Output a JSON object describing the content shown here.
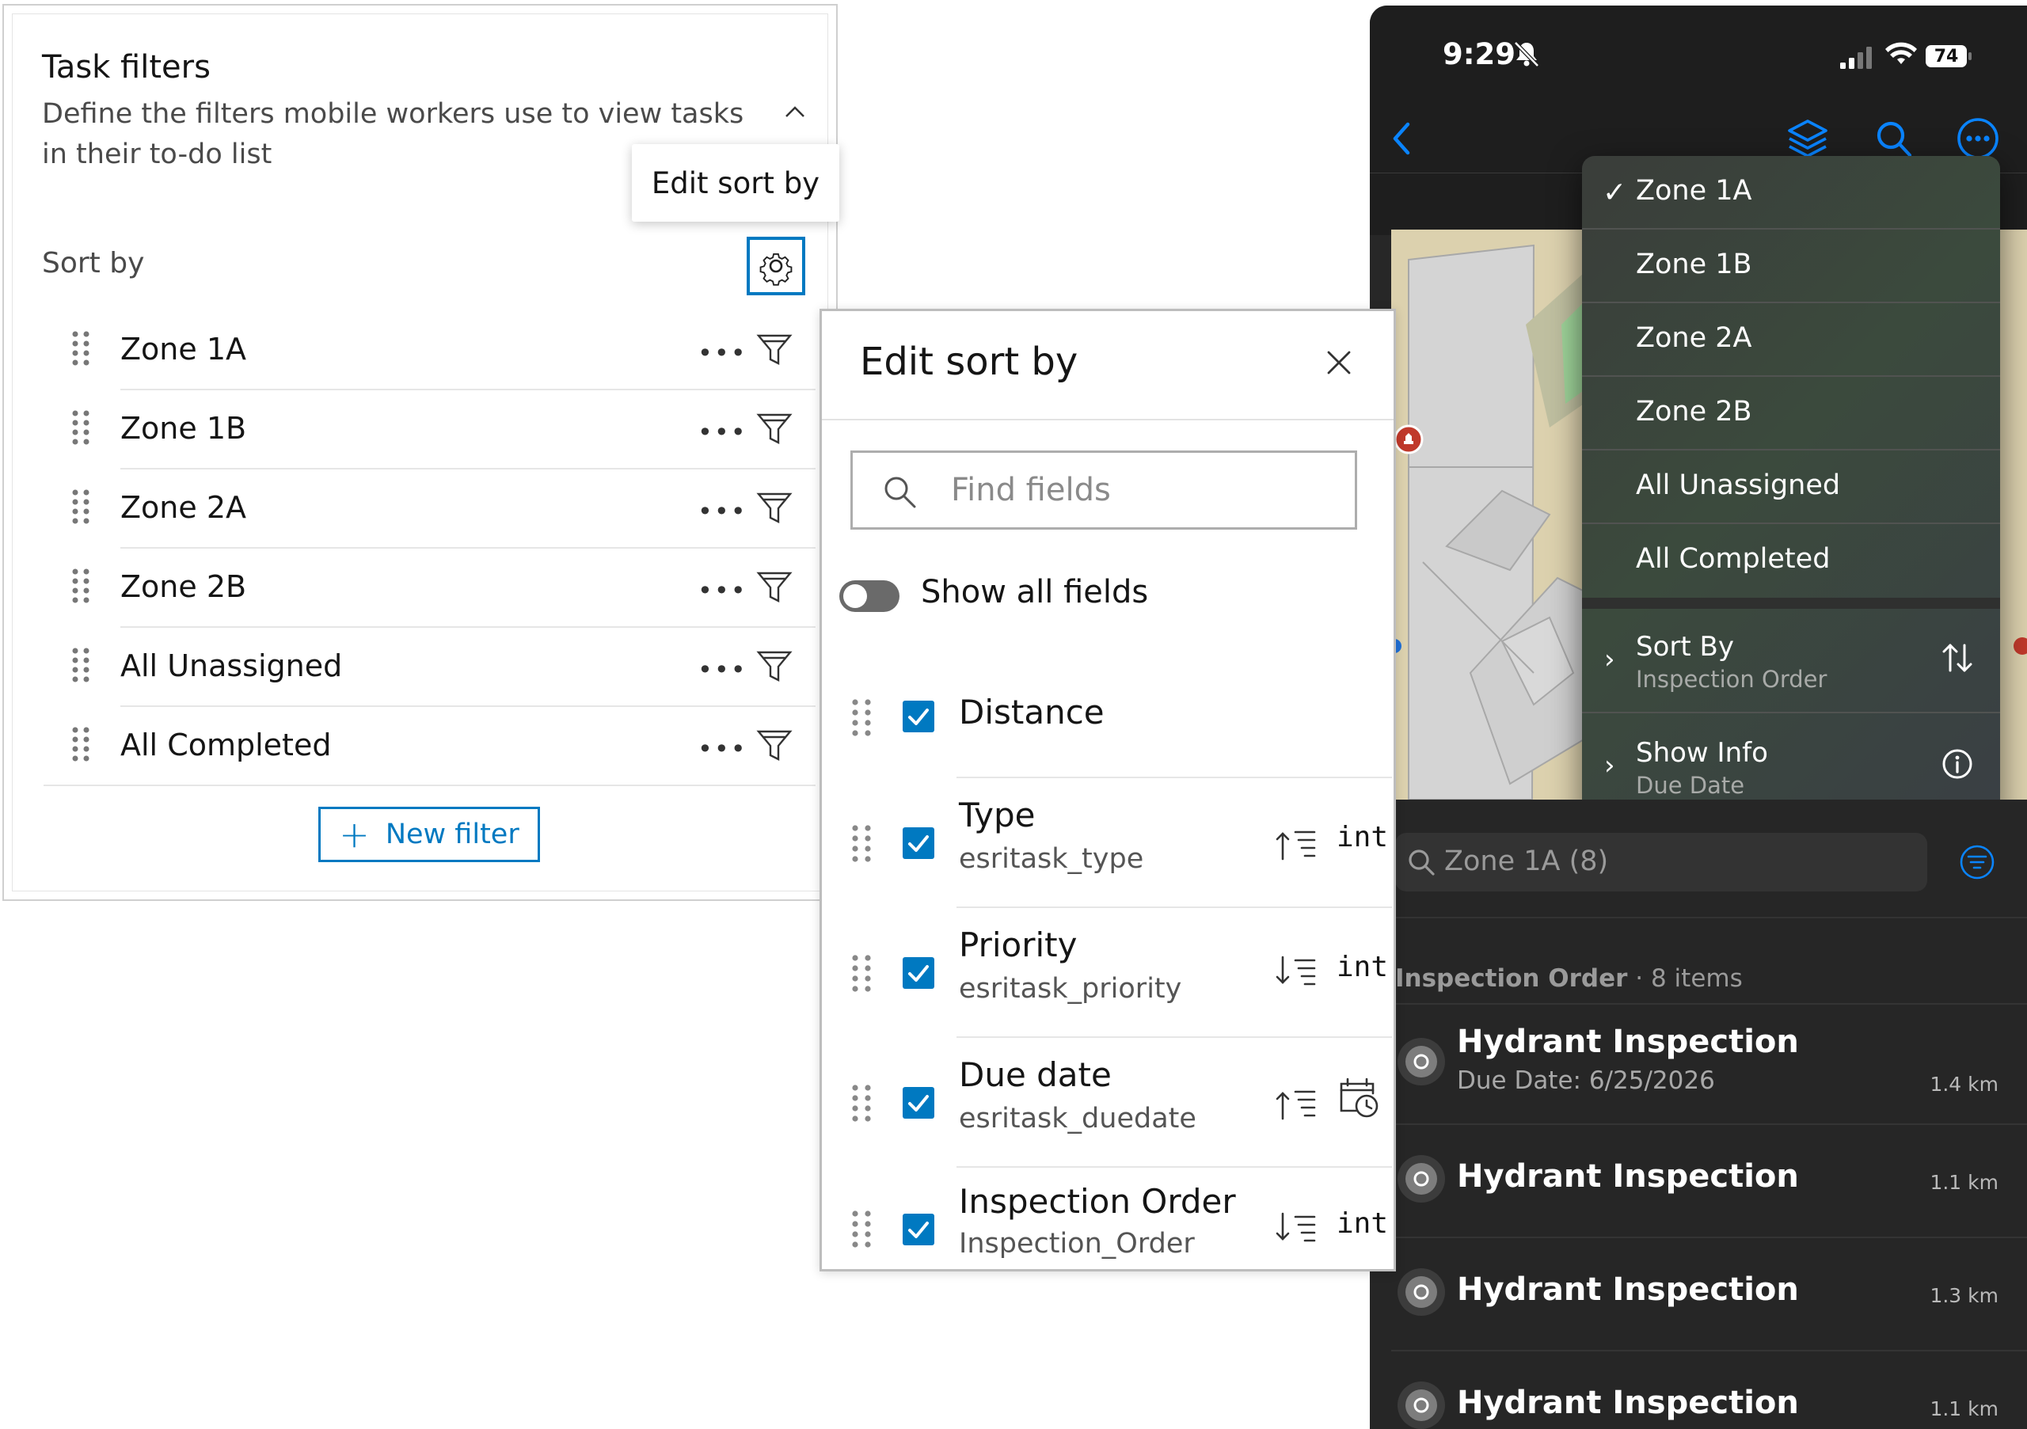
{
  "task_filters": {
    "title": "Task filters",
    "description": "Define the filters mobile workers use to view tasks in their to-do list",
    "tooltip": "Edit sort by",
    "sort_by_label": "Sort by",
    "filters": [
      {
        "label": "Zone 1A"
      },
      {
        "label": "Zone 1B"
      },
      {
        "label": "Zone 2A"
      },
      {
        "label": "Zone 2B"
      },
      {
        "label": "All Unassigned"
      },
      {
        "label": "All Completed"
      }
    ],
    "more_glyph": "•••",
    "new_filter_label": "New filter"
  },
  "edit_sort": {
    "title": "Edit sort by",
    "search_placeholder": "Find fields",
    "show_all_label": "Show all fields",
    "show_all_on": false,
    "fields": [
      {
        "name": "Distance",
        "field": "",
        "checked": true,
        "sort": "",
        "type": ""
      },
      {
        "name": "Type",
        "field": "esritask_type",
        "checked": true,
        "sort": "ascending",
        "type": "int"
      },
      {
        "name": "Priority",
        "field": "esritask_priority",
        "checked": true,
        "sort": "descending",
        "type": "int"
      },
      {
        "name": "Due date",
        "field": "esritask_duedate",
        "checked": true,
        "sort": "ascending",
        "type": "date"
      },
      {
        "name": "Inspection Order",
        "field": "Inspection_Order",
        "checked": true,
        "sort": "descending",
        "type": "int"
      }
    ]
  },
  "mobile": {
    "status": {
      "time": "9:29",
      "battery": "74"
    },
    "menu": {
      "items": [
        {
          "label": "Zone 1A",
          "selected": true
        },
        {
          "label": "Zone 1B",
          "selected": false
        },
        {
          "label": "Zone 2A",
          "selected": false
        },
        {
          "label": "Zone 2B",
          "selected": false
        },
        {
          "label": "All Unassigned",
          "selected": false
        },
        {
          "label": "All Completed",
          "selected": false
        }
      ],
      "check_glyph": "✓",
      "sort_by": {
        "label": "Sort By",
        "value": "Inspection Order"
      },
      "show_info": {
        "label": "Show Info",
        "value": "Due Date"
      }
    },
    "search_text": "Zone 1A (8)",
    "group": {
      "title": "Inspection Order",
      "count": "· 8 items"
    },
    "tasks": [
      {
        "title": "Hydrant Inspection",
        "subtitle": "Due Date: 6/25/2026",
        "distance": "1.4 km"
      },
      {
        "title": "Hydrant Inspection",
        "subtitle": "",
        "distance": "1.1 km"
      },
      {
        "title": "Hydrant Inspection",
        "subtitle": "",
        "distance": "1.3 km"
      },
      {
        "title": "Hydrant Inspection",
        "subtitle": "",
        "distance": "1.1 km"
      }
    ],
    "colors": {
      "accent": "#0a84ff",
      "background": "#262626",
      "marker": "#c0392b"
    }
  },
  "colors": {
    "brand": "#0079c1"
  }
}
